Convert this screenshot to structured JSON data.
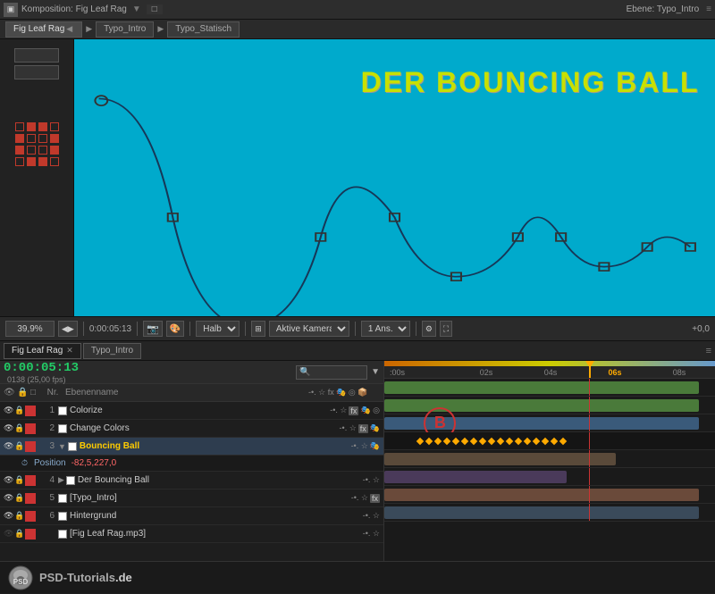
{
  "topbar": {
    "title": "Komposition: Fig Leaf Rag",
    "layer_label": "Ebene: Typo_Intro"
  },
  "tabs": {
    "items": [
      "Fig Leaf Rag",
      "Typo_Intro",
      "Typo_Statisch"
    ]
  },
  "preview": {
    "title": "DER BOUNCING BALL",
    "zoom": "39,9%",
    "time": "0:00:05:13",
    "quality": "Halb",
    "view": "Aktive Kamera",
    "resolution": "1 Ans..."
  },
  "timeline": {
    "tabs": [
      "Fig Leaf Rag",
      "Typo_Intro"
    ],
    "time": "0:00:05:13",
    "fps": "0138 (25,00 fps)",
    "search_placeholder": "🔍",
    "columns": {
      "nr": "Nr.",
      "name": "Ebenenname"
    },
    "layers": [
      {
        "num": "1",
        "color": "#cc3333",
        "name": "Colorize",
        "has_fx": true,
        "has_eye": true
      },
      {
        "num": "2",
        "color": "#cc3333",
        "name": "Change Colors",
        "has_fx": true,
        "has_eye": true
      },
      {
        "num": "3",
        "color": "#cc3333",
        "name": "Bouncing Ball",
        "has_fx": false,
        "has_eye": true,
        "selected": true,
        "expanded": true
      },
      {
        "num": "",
        "color": "",
        "name": "Position",
        "is_sub": true,
        "value": "-82,5,227,0"
      },
      {
        "num": "4",
        "color": "#cc3333",
        "name": "Der Bouncing Ball",
        "has_fx": false,
        "has_eye": true
      },
      {
        "num": "5",
        "color": "#cc3333",
        "name": "[Typo_Intro]",
        "has_fx": true,
        "has_eye": true
      },
      {
        "num": "6",
        "color": "#cc3333",
        "name": "Hintergrund",
        "has_fx": false,
        "has_eye": true
      },
      {
        "num": "",
        "color": "#cc3333",
        "name": "[Fig Leaf Rag.mp3]",
        "has_fx": false,
        "has_eye": false
      }
    ]
  },
  "logo": {
    "text": "PSD-Tutorials.de"
  }
}
